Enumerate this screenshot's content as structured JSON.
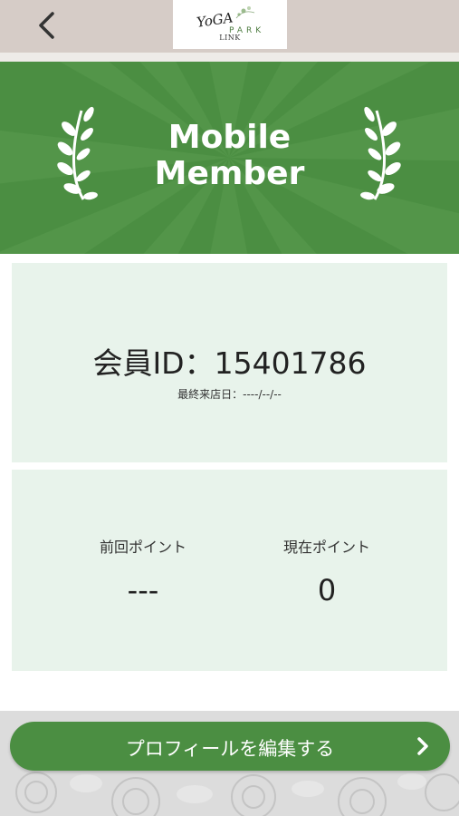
{
  "header": {
    "back_icon": "chevron-left-icon",
    "logo": {
      "word_top": "YoGA",
      "word_bottom": "PARK",
      "sub": "LINK"
    }
  },
  "banner": {
    "title_line1": "Mobile",
    "title_line2": "Member",
    "decoration": "laurel-icon",
    "color": "#4b8e42"
  },
  "member": {
    "id_label": "会員ID：15401786",
    "last_visit": "最終来店日：----/--/--"
  },
  "points": {
    "previous_label": "前回ポイント",
    "previous_value": "---",
    "current_label": "現在ポイント",
    "current_value": "0"
  },
  "footer": {
    "edit_profile_label": "プロフィールを編集する",
    "chevron_icon": "chevron-right-icon"
  },
  "colors": {
    "accent": "#4b8e42",
    "card_bg": "#e8f3eb",
    "header_bg": "#d6ccc7"
  }
}
